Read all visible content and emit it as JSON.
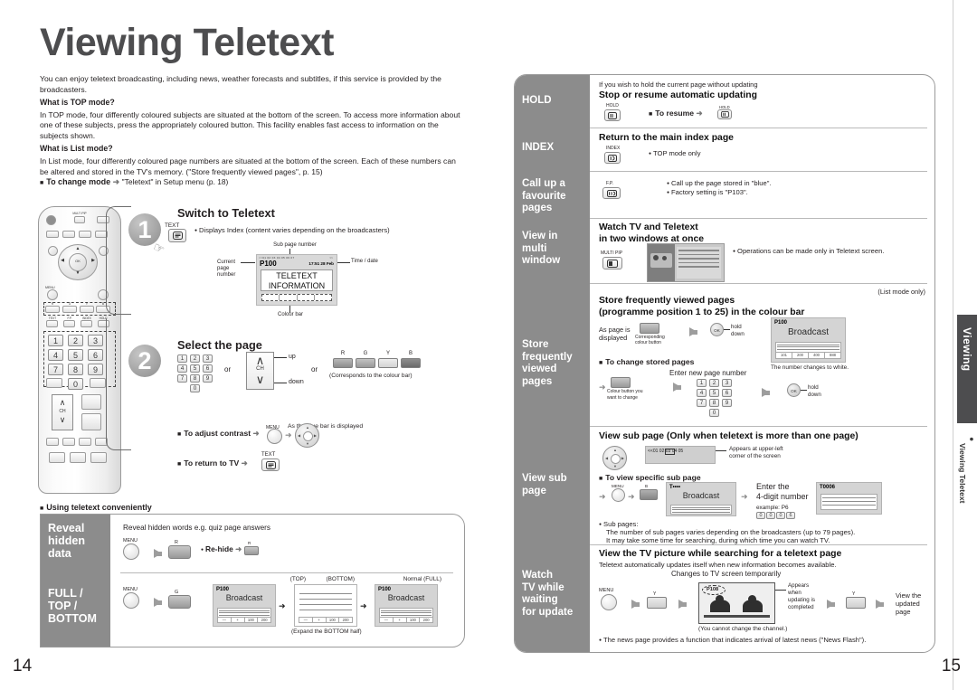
{
  "document": {
    "title": "Viewing Teletext",
    "page_left": "14",
    "page_right": "15"
  },
  "intro": {
    "lead": "You can enjoy teletext broadcasting, including news, weather forecasts and subtitles, if this service is provided by the broadcasters.",
    "top_mode_heading": "What is TOP mode?",
    "top_mode_body": "In TOP mode, four differently coloured subjects are situated at the bottom of the screen. To access more information about one of these subjects, press the appropriately coloured button. This facility enables fast access to information on the subjects shown.",
    "list_mode_heading": "What is List mode?",
    "list_mode_body": "In List mode, four differently coloured page numbers are situated at the bottom of the screen. Each of these numbers can be altered and stored in the TV's memory. (\"Store frequently viewed pages\", p. 15)",
    "change_mode_label": "To change mode",
    "change_mode_value": "\"Teletext\" in Setup menu (p. 18)"
  },
  "step1": {
    "number": "1",
    "title": "Switch to Teletext",
    "button_label": "TEXT",
    "note": "Displays Index (content varies depending on the broadcasters)",
    "callout_sub": "Sub page number",
    "callout_current": "Current",
    "callout_current2": "page",
    "callout_current3": "number",
    "callout_time": "Time / date",
    "callout_colour": "Colour bar",
    "screen": {
      "subpage_row": "<<01 02 03 04 05 06 07",
      "subpage_right": ">>",
      "page_number": "P100",
      "time_date": "17:51 28 Feb",
      "line1": "TELETEXT",
      "line2": "INFORMATION"
    }
  },
  "step2": {
    "number": "2",
    "title": "Select the page",
    "numpad": [
      "1",
      "2",
      "3",
      "4",
      "5",
      "6",
      "7",
      "8",
      "9",
      "0"
    ],
    "or1": "or",
    "or2": "or",
    "ch_label": "CH",
    "up": "up",
    "down": "down",
    "colour_keys": [
      "R",
      "G",
      "Y",
      "B"
    ],
    "colour_note": "(Corresponds to the colour bar)",
    "contrast_label": "To adjust contrast",
    "contrast_menu": "MENU",
    "contrast_note": "As the blue bar is displayed",
    "return_label": "To return to TV",
    "return_key": "TEXT"
  },
  "convenient": {
    "heading": "Using teletext conveniently",
    "rows": [
      {
        "label": "Reveal\nhidden\ndata",
        "title": "Reveal hidden words e.g. quiz page answers",
        "menu": "MENU",
        "key": "R",
        "rehide_label": "Re-hide",
        "rehide_key": "R"
      },
      {
        "label": "FULL /\nTOP /\nBOTTOM",
        "menu": "MENU",
        "key": "G",
        "cap_top": "(TOP)",
        "cap_bottom": "(BOTTOM)",
        "cap_normal": "Normal (FULL)",
        "expand_note": "(Expand the BOTTOM half)",
        "screen_page": "P100",
        "screen_text": "Broadcast",
        "colour_bar": [
          "—",
          "+",
          "100",
          "200"
        ]
      }
    ]
  },
  "right_rows": [
    {
      "label": "HOLD",
      "lead": "If you wish to hold the current page without updating",
      "title": "Stop or resume automatic updating",
      "key_label": "HOLD",
      "resume_label": "To resume",
      "resume_key": "HOLD"
    },
    {
      "label": "INDEX",
      "title": "Return to the main index page",
      "key_label": "INDEX",
      "note": "TOP mode only"
    },
    {
      "label": "Call up a\nfavourite\npages",
      "key_label": "F.P.",
      "note1": "Call up the page stored in \"blue\".",
      "note2": "Factory setting is \"P103\"."
    },
    {
      "label": "View in\nmulti\nwindow",
      "title_line1": "Watch TV and Teletext",
      "title_line2": "in two windows at once",
      "key_label": "MULTI PIP",
      "note": "Operations can be made only in Teletext screen."
    },
    {
      "label": "Store\nfrequently\nviewed\npages",
      "title_line1": "Store frequently viewed pages",
      "title_line2": "(programme position 1 to 25) in the colour bar",
      "mode_note": "(List mode only)",
      "as_page_is": "As page is",
      "displayed": "displayed",
      "corresponding1": "Corresponding",
      "corresponding2": "colour button",
      "ok_label": "OK",
      "hold": "hold",
      "down": "down",
      "tv_page": "P100",
      "tv_text": "Broadcast",
      "tv_bar": [
        "101",
        "200",
        "400",
        "888"
      ],
      "tv_caption": "The number changes to white.",
      "change_label": "To change stored pages",
      "enter_new": "Enter new page number",
      "colour_button1": "Colour button you",
      "colour_button2": "want to change",
      "numpad": [
        "1",
        "2",
        "3",
        "4",
        "5",
        "6",
        "7",
        "8",
        "9",
        "0"
      ],
      "ok2_label": "OK",
      "hold2": "hold",
      "down2": "down"
    },
    {
      "label": "View sub\npage",
      "title": "View sub page (Only when teletext is more than one page)",
      "subrow": "<<01 02 03 04 05",
      "subrow_hi": "02",
      "appear1": "Appears at upper-left",
      "appear2": "corner of the screen",
      "specific_label": "To view specific sub page",
      "menu": "MENU",
      "key": "B",
      "tv_page": "T••••",
      "tv_text": "Broadcast",
      "enter1": "Enter the",
      "enter2": "4-digit number",
      "example": "example: P6",
      "example_digits": [
        "0",
        "0",
        "0",
        "6"
      ],
      "result_page": "T0006",
      "sub_label": "Sub pages:",
      "sub_note1": "The number of sub pages varies depending on the broadcasters (up to 79 pages).",
      "sub_note2": "It may take some time for searching, during which time you can watch TV."
    },
    {
      "label": "Watch\nTV while\nwaiting\nfor update",
      "title": "View the TV picture while searching for a teletext page",
      "lead": "Teletext automatically updates itself when new information becomes available.",
      "changes_note": "Changes to TV screen temporarily",
      "menu": "MENU",
      "key1": "Y",
      "tv_page": "P108",
      "appear1": "Appears",
      "appear2": "when",
      "appear3": "updating is",
      "appear4": "completed",
      "key2": "Y",
      "view1": "View the",
      "view2": "updated",
      "view3": "page",
      "cannot_note": "(You cannot change the channel.)",
      "news_note": "The news page provides a function that indicates arrival of latest news (\"News Flash\")."
    }
  ],
  "side_tab": {
    "primary": "Viewing",
    "secondary": "Viewing Teletext"
  },
  "remote": {
    "multi_pip": "MULTI PIP",
    "menu": "MENU",
    "ok": "OK",
    "colour_row": [
      "R",
      "G",
      "Y",
      "B"
    ],
    "func_row": [
      "TEXT",
      "F.P.",
      "INDEX",
      "HOLD"
    ],
    "numpad": [
      "1",
      "2",
      "3",
      "4",
      "5",
      "6",
      "7",
      "8",
      "9",
      "0"
    ],
    "ch": "CH"
  },
  "colors": {
    "label_grey": "#8c8c8c",
    "title_grey": "#4d4d4f",
    "tab_dark": "#4d4d4f",
    "red": "#c63b2f",
    "green": "#6f9c4e",
    "yellow": "#e8e48f",
    "blue": "#4a4f77"
  }
}
